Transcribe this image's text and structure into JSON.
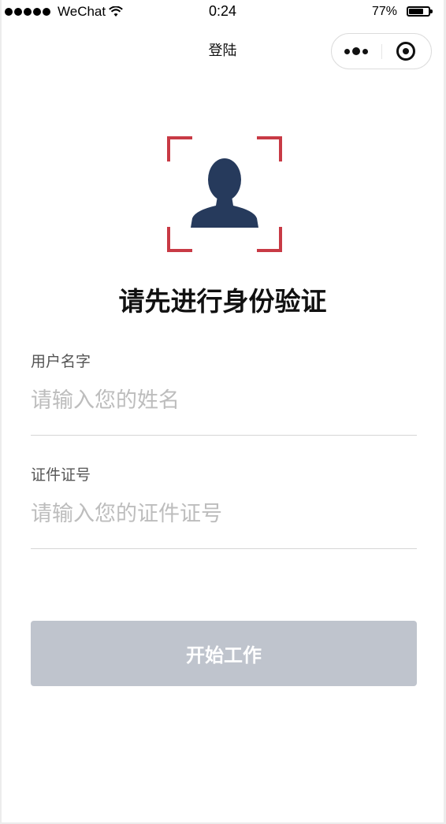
{
  "status_bar": {
    "carrier": "WeChat",
    "time": "0:24",
    "battery_percent_label": "77%",
    "battery_level": 0.77
  },
  "nav": {
    "title": "登陆"
  },
  "page": {
    "heading": "请先进行身份验证"
  },
  "form": {
    "name_label": "用户名字",
    "name_placeholder": "请输入您的姓名",
    "id_label": "证件证号",
    "id_placeholder": "请输入您的证件证号"
  },
  "actions": {
    "start_label": "开始工作"
  },
  "colors": {
    "frame_accent": "#c83a45",
    "avatar": "#263a5c",
    "button_disabled": "#bfc4cd"
  }
}
